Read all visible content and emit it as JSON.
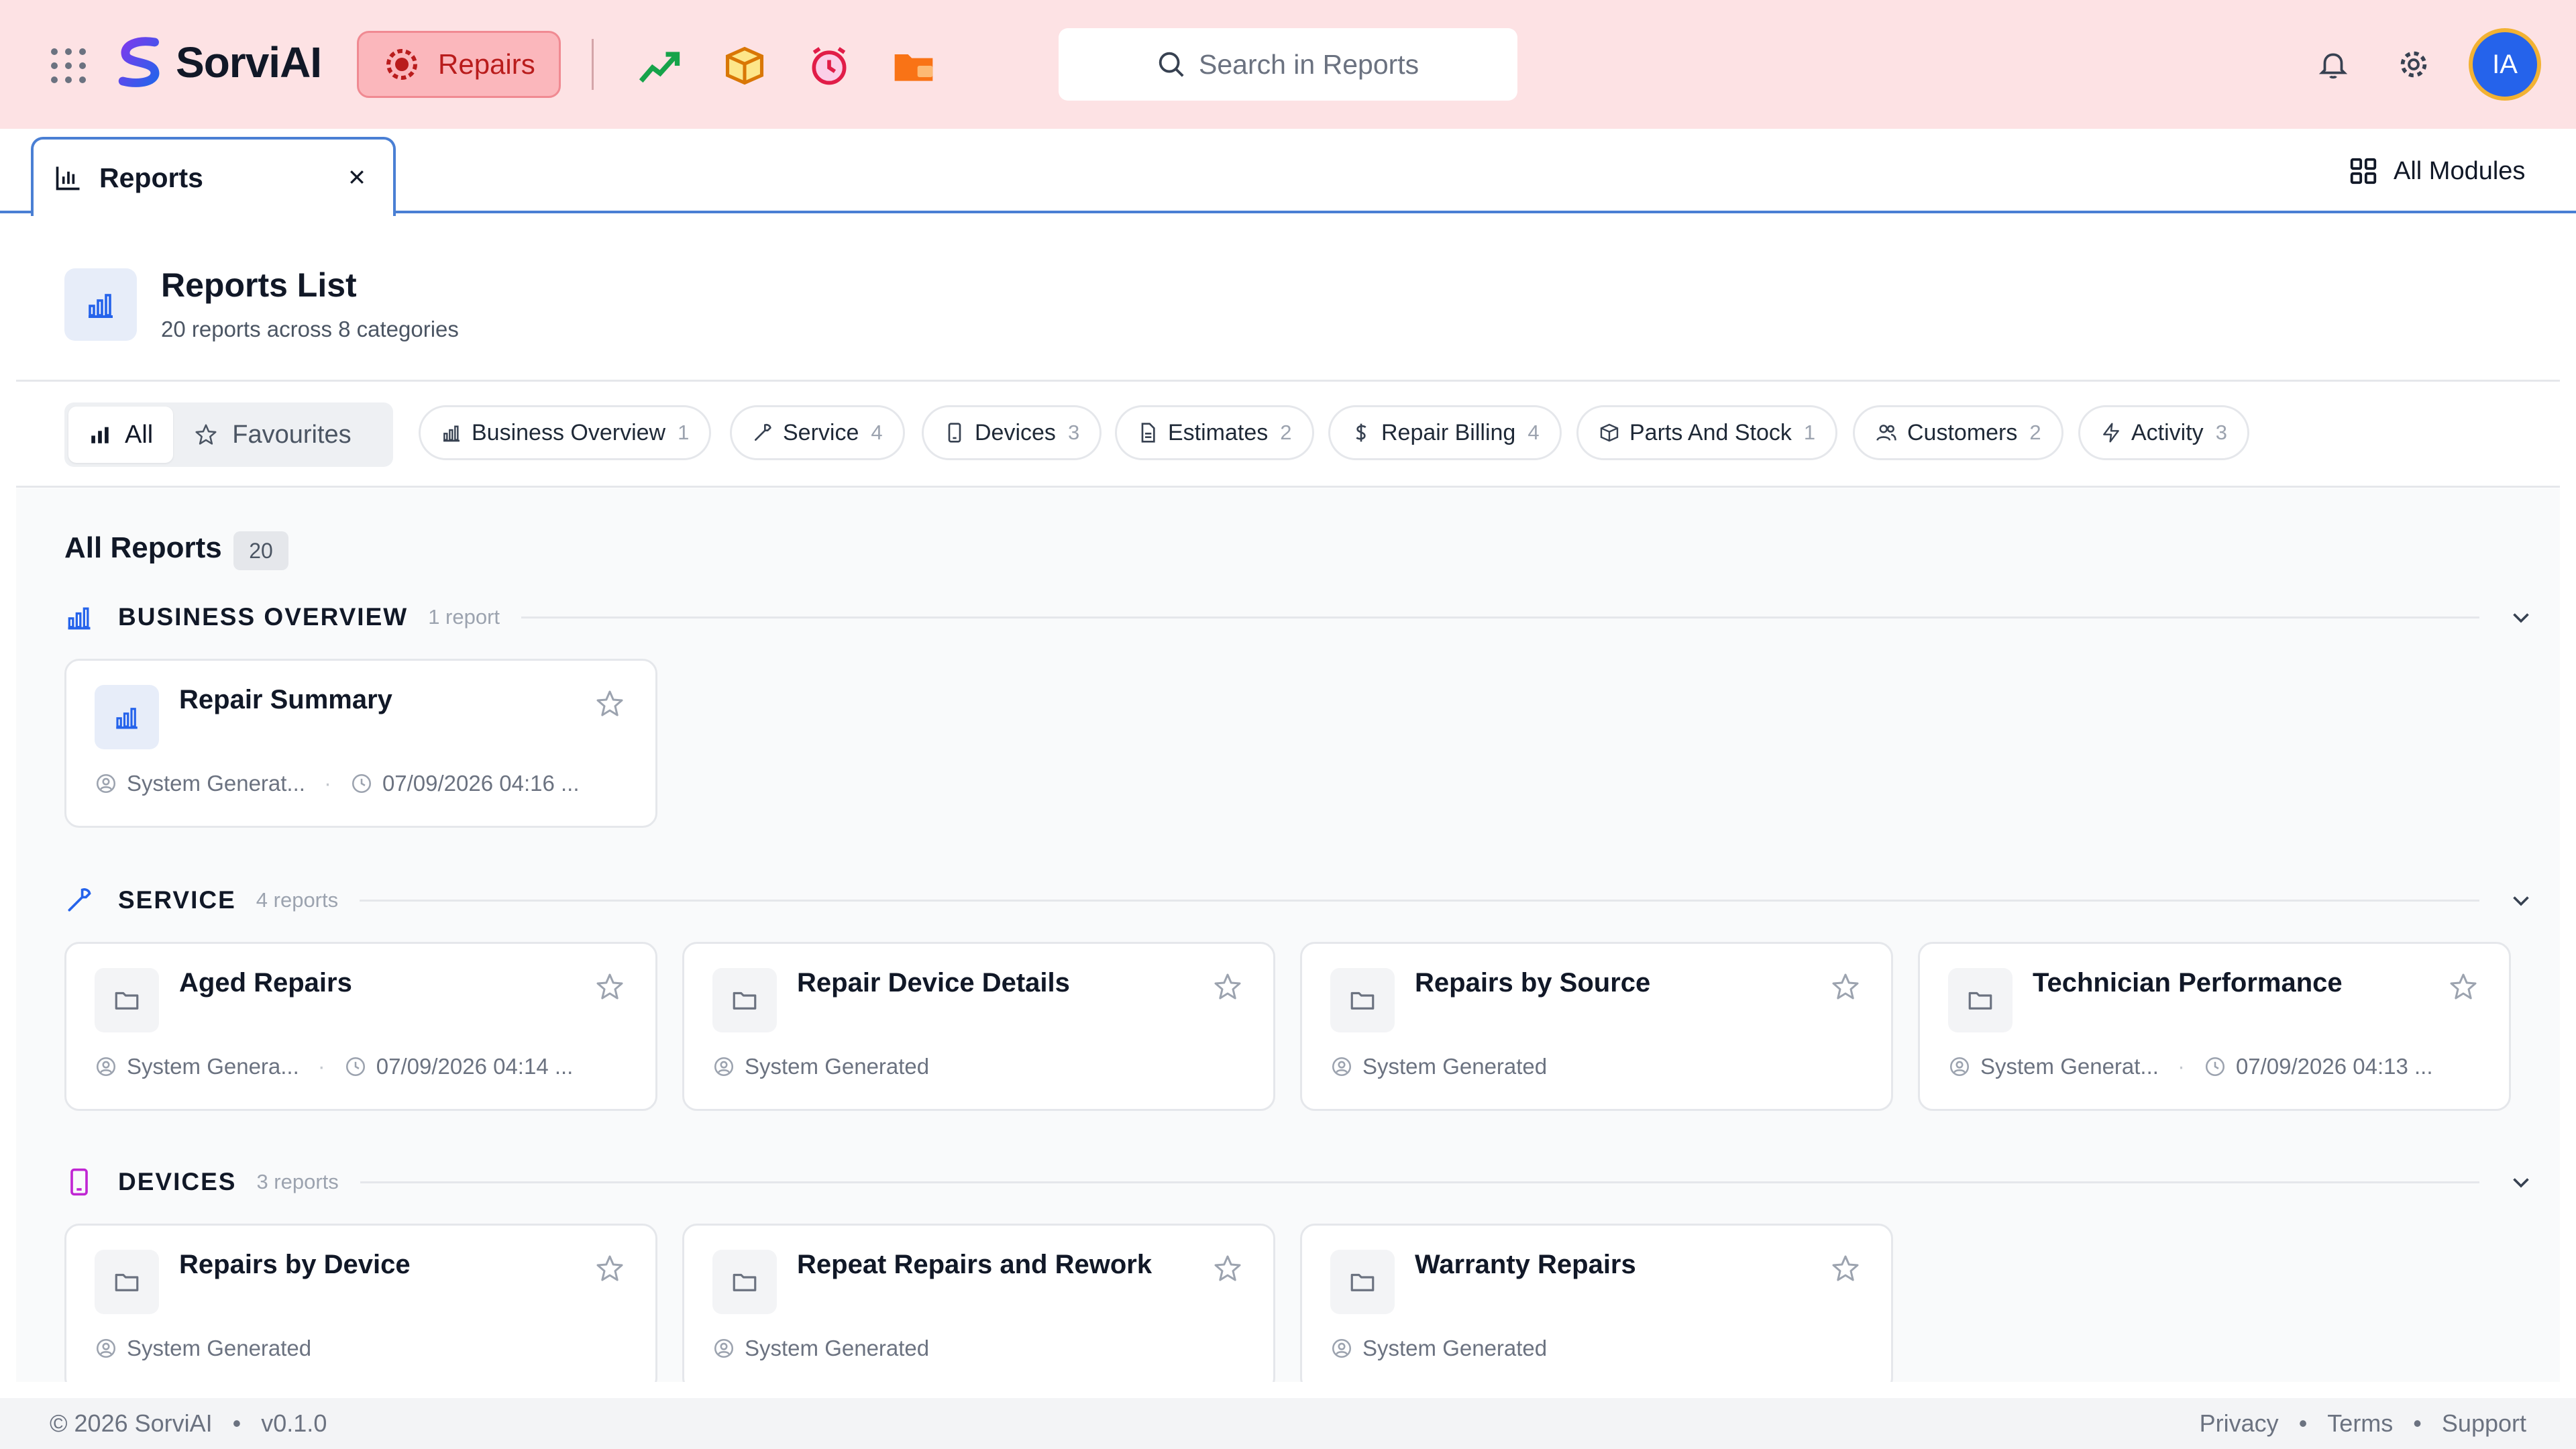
{
  "brand": {
    "name": "SorviAI"
  },
  "module": {
    "label": "Repairs"
  },
  "search": {
    "placeholder": "Search in Reports"
  },
  "user": {
    "initials": "IA"
  },
  "tab": {
    "label": "Reports"
  },
  "all_modules": {
    "label": "All Modules"
  },
  "header": {
    "title": "Reports List",
    "subtitle": "20 reports across 8 categories"
  },
  "filters": {
    "all_label": "All",
    "fav_label": "Favourites",
    "chips": [
      {
        "label": "Business Overview",
        "count": "1"
      },
      {
        "label": "Service",
        "count": "4"
      },
      {
        "label": "Devices",
        "count": "3"
      },
      {
        "label": "Estimates",
        "count": "2"
      },
      {
        "label": "Repair Billing",
        "count": "4"
      },
      {
        "label": "Parts And Stock",
        "count": "1"
      },
      {
        "label": "Customers",
        "count": "2"
      },
      {
        "label": "Activity",
        "count": "3"
      }
    ]
  },
  "all_reports": {
    "title": "All Reports",
    "count": "20"
  },
  "sections": [
    {
      "name": "BUSINESS OVERVIEW",
      "count": "1 report",
      "cards": [
        {
          "title": "Repair Summary",
          "author": "System Generat...",
          "date": "07/09/2026 04:16 ..."
        }
      ]
    },
    {
      "name": "SERVICE",
      "count": "4 reports",
      "cards": [
        {
          "title": "Aged Repairs",
          "author": "System Genera...",
          "date": "07/09/2026 04:14 ..."
        },
        {
          "title": "Repair Device Details",
          "author": "System Generated"
        },
        {
          "title": "Repairs by Source",
          "author": "System Generated"
        },
        {
          "title": "Technician Performance",
          "author": "System Generat...",
          "date": "07/09/2026 04:13 ..."
        }
      ]
    },
    {
      "name": "DEVICES",
      "count": "3 reports",
      "cards": [
        {
          "title": "Repairs by Device",
          "author": "System Generated"
        },
        {
          "title": "Repeat Repairs and Rework",
          "author": "System Generated"
        },
        {
          "title": "Warranty Repairs",
          "author": "System Generated"
        }
      ]
    }
  ],
  "footer": {
    "copyright": "© 2026 SorviAI",
    "version": "v0.1.0",
    "links": [
      "Privacy",
      "Terms",
      "Support"
    ]
  },
  "colors": {
    "topbar": "#fde2e4",
    "accent": "#2563eb",
    "module_text": "#b91c1c",
    "tab_border": "#4a7fd4"
  }
}
